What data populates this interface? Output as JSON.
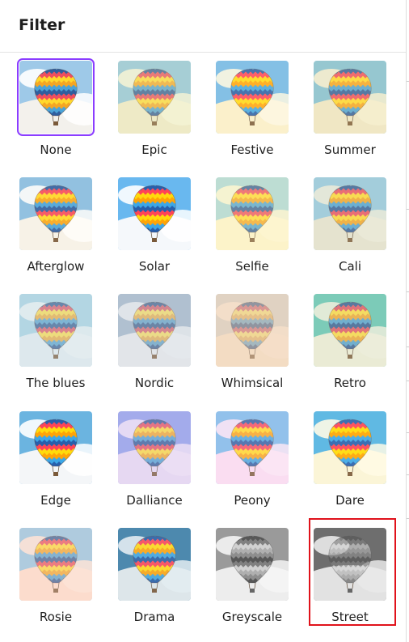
{
  "panel": {
    "title": "Filter"
  },
  "filters": [
    {
      "label": "None",
      "name": "filter-none",
      "sky": "#9ec9e8",
      "cloud": "#ffffff",
      "ground": "#f3f1ec",
      "sat": 1.0,
      "tint": "#ffffff",
      "tintOp": 0.0,
      "gray": false,
      "selected": true
    },
    {
      "label": "Epic",
      "name": "filter-epic",
      "sky": "#8cc3dd",
      "cloud": "#f4f4dc",
      "ground": "#ece9c9",
      "sat": 0.9,
      "tint": "#f3efc0",
      "tintOp": 0.25,
      "gray": false
    },
    {
      "label": "Festive",
      "name": "filter-festive",
      "sky": "#6fb8ea",
      "cloud": "#fdf8e6",
      "ground": "#fbf0cc",
      "sat": 1.15,
      "tint": "#fff3c8",
      "tintOp": 0.15,
      "gray": false
    },
    {
      "label": "Summer",
      "name": "filter-summer",
      "sky": "#7fc0d8",
      "cloud": "#f7f1d6",
      "ground": "#efe8c8",
      "sat": 1.0,
      "tint": "#f4e8b6",
      "tintOp": 0.2,
      "gray": false
    },
    {
      "label": "Afterglow",
      "name": "filter-afterglow",
      "sky": "#86bde2",
      "cloud": "#ffffff",
      "ground": "#f7f3ea",
      "sat": 1.05,
      "tint": "#ffe8cf",
      "tintOp": 0.1,
      "gray": false
    },
    {
      "label": "Solar",
      "name": "filter-solar",
      "sky": "#69b8ef",
      "cloud": "#ffffff",
      "ground": "#f5f8fb",
      "sat": 1.2,
      "tint": "#ffffff",
      "tintOp": 0.0,
      "gray": false
    },
    {
      "label": "Selfie",
      "name": "filter-selfie",
      "sky": "#a7d6da",
      "cloud": "#fbf6d6",
      "ground": "#fbf3cc",
      "sat": 0.95,
      "tint": "#fff4c0",
      "tintOp": 0.25,
      "gray": false
    },
    {
      "label": "Cali",
      "name": "filter-cali",
      "sky": "#93c7df",
      "cloud": "#ecebdc",
      "ground": "#e5e3d0",
      "sat": 0.95,
      "tint": "#e8e6cf",
      "tintOp": 0.2,
      "gray": false
    },
    {
      "label": "The blues",
      "name": "filter-the-blues",
      "sky": "#a4cfdf",
      "cloud": "#e9eef0",
      "ground": "#e0e8ec",
      "sat": 0.8,
      "tint": "#d8e8f0",
      "tintOp": 0.3,
      "gray": false
    },
    {
      "label": "Nordic",
      "name": "filter-nordic",
      "sky": "#9db1c4",
      "cloud": "#e8eaec",
      "ground": "#e4e6e9",
      "sat": 0.7,
      "tint": "#dfe4ea",
      "tintOp": 0.3,
      "gray": false
    },
    {
      "label": "Whimsical",
      "name": "filter-whimsical",
      "sky": "#cfcac0",
      "cloud": "#f6e2cd",
      "ground": "#f3dcc2",
      "sat": 0.6,
      "tint": "#f3dcc5",
      "tintOp": 0.45,
      "gray": false
    },
    {
      "label": "Retro",
      "name": "filter-retro",
      "sky": "#62c3b2",
      "cloud": "#eeeedd",
      "ground": "#ecebd6",
      "sat": 0.85,
      "tint": "#e6ecd3",
      "tintOp": 0.2,
      "gray": false
    },
    {
      "label": "Edge",
      "name": "filter-edge",
      "sky": "#6bb4e0",
      "cloud": "#ffffff",
      "ground": "#f4f6f8",
      "sat": 1.2,
      "tint": "#ffffff",
      "tintOp": 0.0,
      "gray": false
    },
    {
      "label": "Dalliance",
      "name": "filter-dalliance",
      "sky": "#8e9ce8",
      "cloud": "#efe2f5",
      "ground": "#e7d9f2",
      "sat": 0.9,
      "tint": "#e3d6f5",
      "tintOp": 0.25,
      "gray": false
    },
    {
      "label": "Peony",
      "name": "filter-peony",
      "sky": "#79b9ea",
      "cloud": "#fbe7f6",
      "ground": "#fbdcf2",
      "sat": 1.05,
      "tint": "#fbe0f2",
      "tintOp": 0.2,
      "gray": false
    },
    {
      "label": "Dare",
      "name": "filter-dare",
      "sky": "#4fb3e6",
      "cloud": "#fffbe9",
      "ground": "#fbf5d8",
      "sat": 1.25,
      "tint": "#fff4d0",
      "tintOp": 0.1,
      "gray": false
    },
    {
      "label": "Rosie",
      "name": "filter-rosie",
      "sky": "#8fc5e6",
      "cloud": "#fde6da",
      "ground": "#fcddcd",
      "sat": 0.9,
      "tint": "#fddccc",
      "tintOp": 0.3,
      "gray": false
    },
    {
      "label": "Drama",
      "name": "filter-drama",
      "sky": "#3f7fa8",
      "cloud": "#e6eef2",
      "ground": "#dfe7ea",
      "sat": 1.1,
      "tint": "#cfe3ec",
      "tintOp": 0.1,
      "gray": false
    },
    {
      "label": "Greyscale",
      "name": "filter-greyscale",
      "sky": "#9a9a9a",
      "cloud": "#f4f4f4",
      "ground": "#ededed",
      "sat": 0.0,
      "tint": "#ffffff",
      "tintOp": 0.0,
      "gray": true
    },
    {
      "label": "Street",
      "name": "filter-street",
      "sky": "#6e6e6e",
      "cloud": "#e9e9e9",
      "ground": "#e2e2e2",
      "sat": 0.0,
      "tint": "#ffffff",
      "tintOp": 0.0,
      "gray": true,
      "dark": true
    }
  ],
  "highlight": {
    "target": "Street"
  }
}
